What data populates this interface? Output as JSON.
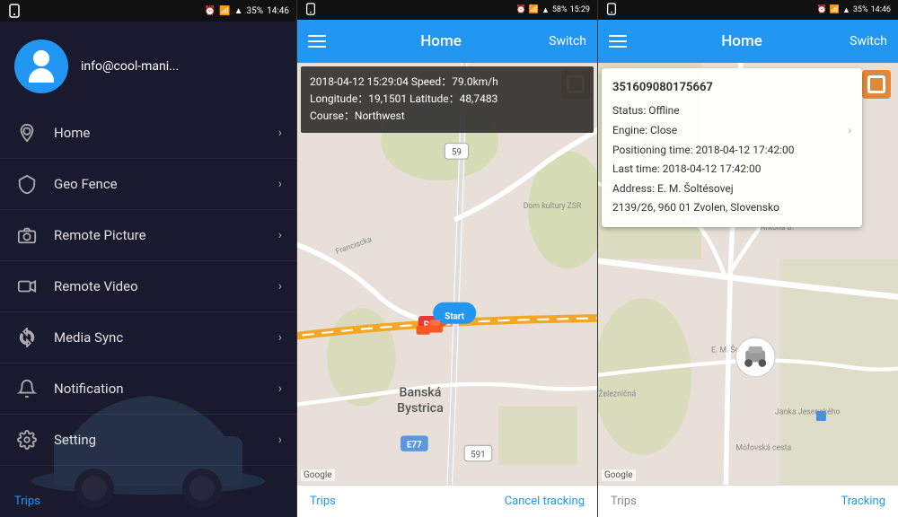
{
  "panel1": {
    "statusBar": {
      "time": "14:46",
      "battery": "35%"
    },
    "profile": {
      "email": "info@cool-mani..."
    },
    "menu": {
      "items": [
        {
          "id": "home",
          "label": "Home",
          "icon": "location"
        },
        {
          "id": "geo-fence",
          "label": "Geo Fence",
          "icon": "shield"
        },
        {
          "id": "remote-picture",
          "label": "Remote Picture",
          "icon": "camera"
        },
        {
          "id": "remote-video",
          "label": "Remote Video",
          "icon": "video"
        },
        {
          "id": "media-sync",
          "label": "Media Sync",
          "icon": "sync"
        },
        {
          "id": "notification",
          "label": "Notification",
          "icon": "bell"
        },
        {
          "id": "setting",
          "label": "Setting",
          "icon": "gear"
        }
      ]
    },
    "tripsLink": "Trips"
  },
  "panel2": {
    "statusBar": {
      "time": "15:29",
      "battery": "58%"
    },
    "header": {
      "title": "Home",
      "switchLabel": "Switch"
    },
    "infoPopup": {
      "line1": "2018-04-12 15:29:04   Speed：79.0km/h",
      "line2": "Longitude：19,1501   Latitude：48,7483",
      "line3": "Course：Northwest"
    },
    "mapLabels": {
      "banska": "Banská\nBystrica",
      "google": "Google"
    },
    "bottomBar": {
      "trips": "Trips",
      "cancelTracking": "Cancel tracking"
    }
  },
  "panel3": {
    "statusBar": {
      "time": "14:46",
      "battery": "35%"
    },
    "header": {
      "title": "Home",
      "switchLabel": "Switch"
    },
    "deviceCard": {
      "deviceId": "351609080175667",
      "status": "Status:  Offline",
      "engine": "Engine:  Close",
      "positioningTime": "Positioning time:  2018-04-12 17:42:00",
      "lastTime": "Last time:  2018-04-12 17:42:00",
      "address": "Address:  E. M. Šoltésovej\n2139/26, 960 01 Zvolen, Slovensko"
    },
    "bottomBar": {
      "trips": "Trips",
      "tracking": "Tracking"
    }
  }
}
